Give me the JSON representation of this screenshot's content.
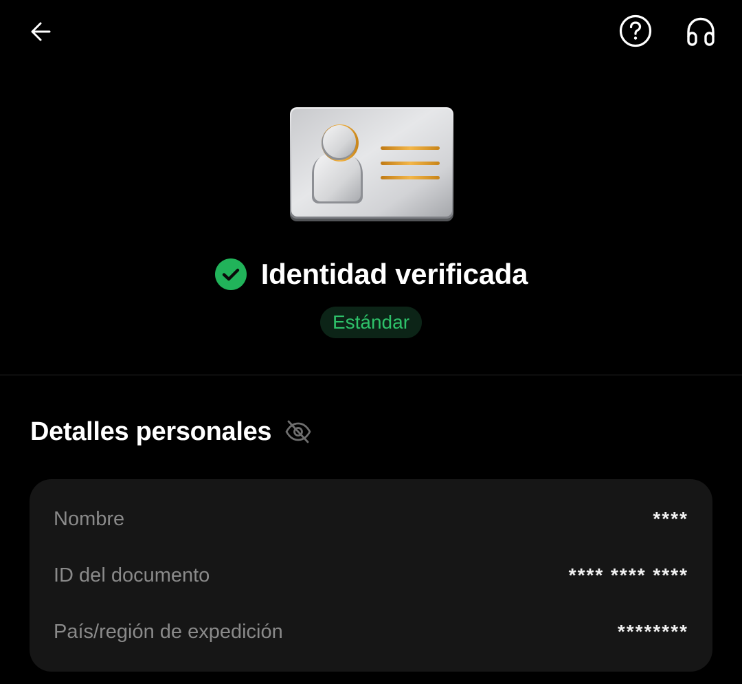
{
  "header": {
    "back_icon": "arrow-left-icon",
    "help_icon": "help-circle-icon",
    "support_icon": "headphones-icon"
  },
  "hero": {
    "illustration": "id-card-illustration"
  },
  "status": {
    "icon": "check-circle-icon",
    "title": "Identidad verificada",
    "badge": "Estándar",
    "accent_color": "#21b35a"
  },
  "details": {
    "title": "Detalles personales",
    "visibility_icon": "eye-off-icon",
    "rows": [
      {
        "label": "Nombre",
        "value": "****"
      },
      {
        "label": "ID del documento",
        "value": "**** **** ****"
      },
      {
        "label": "País/región de expedición",
        "value": "********"
      }
    ]
  }
}
